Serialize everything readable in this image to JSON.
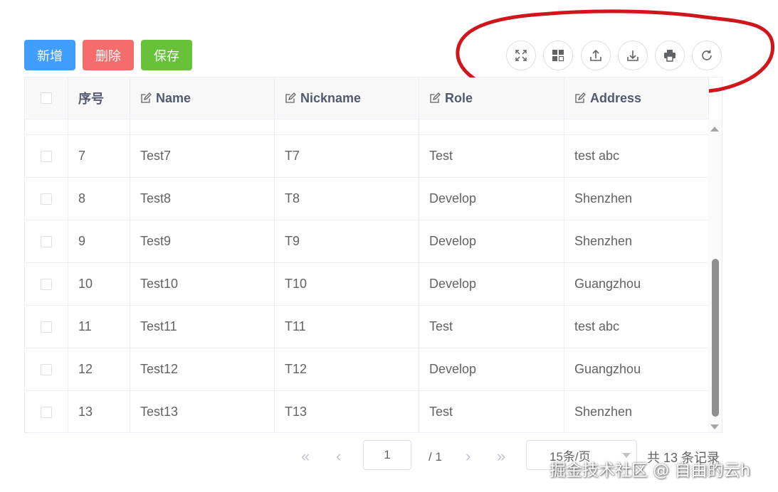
{
  "toolbar": {
    "add_label": "新增",
    "delete_label": "删除",
    "save_label": "保存",
    "tools": [
      "fullscreen-icon",
      "custom-columns-icon",
      "import-icon",
      "export-icon",
      "print-icon",
      "refresh-icon"
    ]
  },
  "table": {
    "headers": {
      "index": "序号",
      "name": "Name",
      "nickname": "Nickname",
      "role": "Role",
      "address": "Address"
    },
    "rows": [
      {
        "index": "7",
        "name": "Test7",
        "nickname": "T7",
        "role": "Test",
        "address": "test abc"
      },
      {
        "index": "8",
        "name": "Test8",
        "nickname": "T8",
        "role": "Develop",
        "address": "Shenzhen"
      },
      {
        "index": "9",
        "name": "Test9",
        "nickname": "T9",
        "role": "Develop",
        "address": "Shenzhen"
      },
      {
        "index": "10",
        "name": "Test10",
        "nickname": "T10",
        "role": "Develop",
        "address": "Guangzhou"
      },
      {
        "index": "11",
        "name": "Test11",
        "nickname": "T11",
        "role": "Test",
        "address": "test abc"
      },
      {
        "index": "12",
        "name": "Test12",
        "nickname": "T12",
        "role": "Develop",
        "address": "Guangzhou"
      },
      {
        "index": "13",
        "name": "Test13",
        "nickname": "T13",
        "role": "Test",
        "address": "Shenzhen"
      }
    ]
  },
  "pager": {
    "current_page": "1",
    "total_pages": "/ 1",
    "page_size": "15条/页",
    "total_count": "共 13 条记录"
  },
  "watermark": "掘金技术社区 @ 自由的云h",
  "colors": {
    "primary": "#409eff",
    "danger": "#f56c6c",
    "success": "#67c23a",
    "annotation": "#d0161b"
  }
}
